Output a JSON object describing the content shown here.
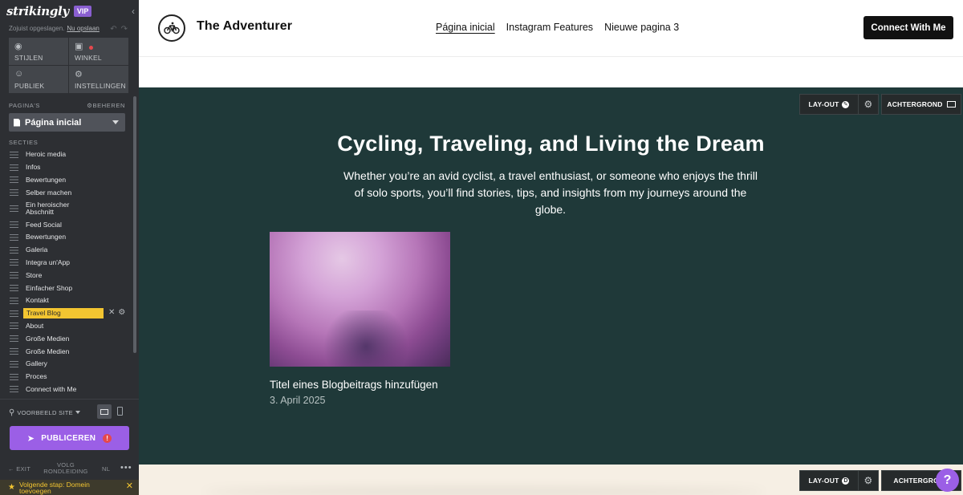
{
  "sidebar": {
    "logo": "strikingly",
    "vip_badge": "VIP",
    "saved_text": "Zojuist opgeslagen.",
    "save_now_link": "Nu opslaan",
    "tools": [
      {
        "label": "STIJLEN",
        "icon": "palette-icon"
      },
      {
        "label": "WINKEL",
        "icon": "lock-icon"
      },
      {
        "label": "PUBLIEK",
        "icon": "users-icon"
      },
      {
        "label": "INSTELLINGEN",
        "icon": "gear-icon"
      }
    ],
    "pages_heading": "PAGINA'S",
    "manage_label": "BEHEREN",
    "current_page": "Página inicial",
    "sections_heading": "SECTIES",
    "sections": [
      "Heroic media",
      "Infos",
      "Bewertungen",
      "Selber machen",
      "Ein heroischer Abschnitt",
      "Feed Social",
      "Bewertungen",
      "Galeria",
      "Integra un'App",
      "Store",
      "Einfacher Shop",
      "Kontakt",
      "Travel Blog",
      "About",
      "Große Medien",
      "Große Medien",
      "Gallery",
      "Proces",
      "Connect with Me"
    ],
    "active_section": "Travel Blog",
    "preview_label": "VOORBEELD SITE",
    "publish_label": "PUBLICEREN",
    "publish_alert": "!",
    "exit_label": "EXIT",
    "tour_label": "VOLG RONDLEIDING",
    "lang_label": "NL",
    "next_step_text": "Volgende stap: Domein toevoegen"
  },
  "site": {
    "brand_name": "The Adventurer",
    "nav": [
      "Página inicial",
      "Instagram Features",
      "Nieuwe pagina 3"
    ],
    "cta_label": "Connect With Me",
    "hero_title": "Cycling, Traveling, and Living the Dream",
    "hero_subtitle": "Whether you’re an avid cyclist, a travel enthusiast, or someone who enjoys the thrill of solo sports, you’ll find stories, tips, and insights from my journeys around the globe.",
    "blog_post_title": "Titel eines Blogbeitrags hinzufügen",
    "blog_post_date": "3. April 2025"
  },
  "editor": {
    "layout_label": "LAY-OUT",
    "background_label": "ACHTERGROND",
    "help_label": "?"
  },
  "colors": {
    "sidebar_bg": "#2d2f33",
    "accent_purple": "#9b5fe6",
    "hero_bg": "#1f3939",
    "active_section_yellow": "#f3c531"
  }
}
